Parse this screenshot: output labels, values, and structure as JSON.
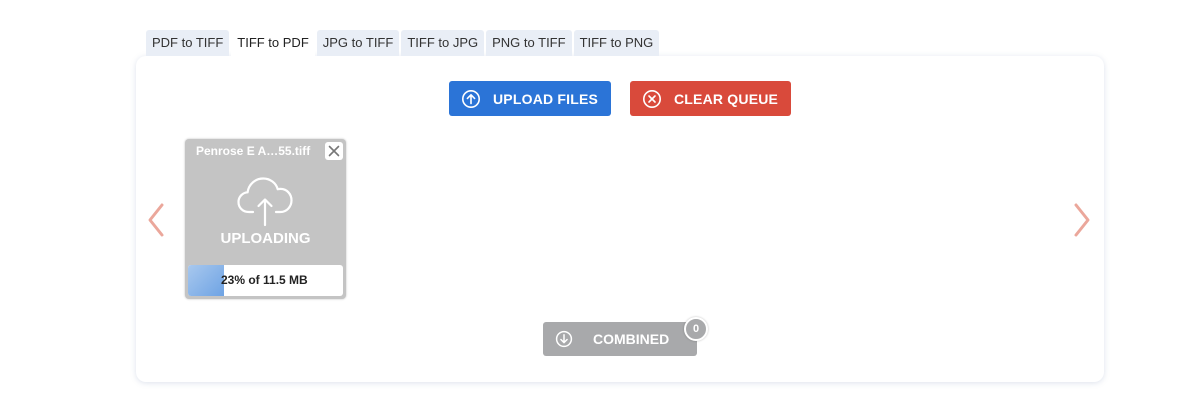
{
  "tabs": [
    {
      "label": "PDF to TIFF",
      "active": false
    },
    {
      "label": "TIFF to PDF",
      "active": true
    },
    {
      "label": "JPG to TIFF",
      "active": false
    },
    {
      "label": "TIFF to JPG",
      "active": false
    },
    {
      "label": "PNG to TIFF",
      "active": false
    },
    {
      "label": "TIFF to PNG",
      "active": false
    }
  ],
  "toolbar": {
    "upload_label": "UPLOAD FILES",
    "upload_icon": "upload-circle-icon",
    "clear_label": "CLEAR QUEUE",
    "clear_icon": "close-circle-icon"
  },
  "queue": {
    "files": [
      {
        "name": "Penrose E A…55.tiff",
        "status": "UPLOADING",
        "progress_percent": 23,
        "progress_text": "23% of 11.5 MB"
      }
    ]
  },
  "combined": {
    "label": "COMBINED",
    "count": "0",
    "icon": "download-circle-icon"
  },
  "colors": {
    "upload": "#2b74d7",
    "clear": "#d94a3b",
    "combined": "#a8a9ab",
    "arrow": "#eba79b",
    "card": "#c4c4c4"
  }
}
